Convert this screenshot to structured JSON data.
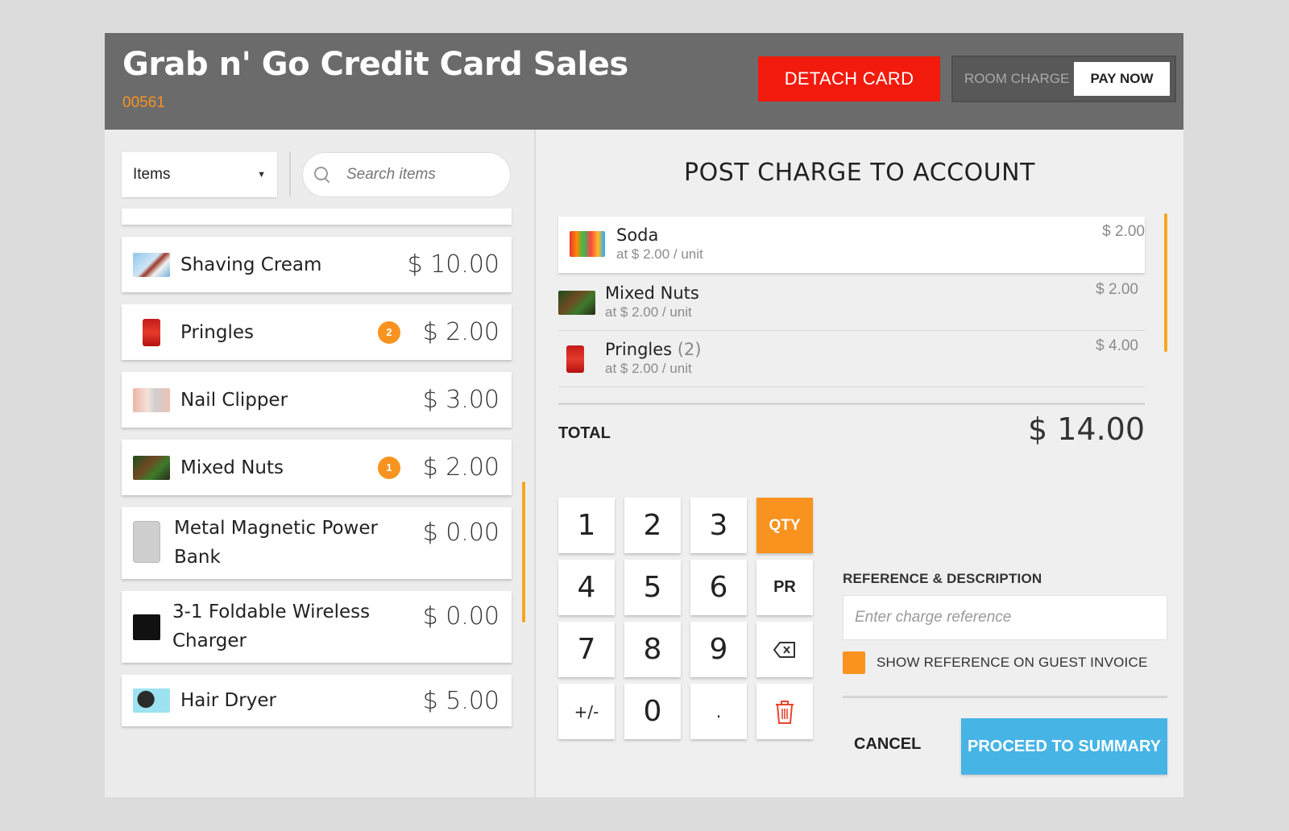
{
  "header": {
    "title": "Grab n' Go Credit Card Sales",
    "id": "00561",
    "detach_label": "DETACH CARD",
    "room_charge_label": "ROOM CHARGE",
    "pay_now_label": "PAY NOW"
  },
  "filter": {
    "category": "Items",
    "search_placeholder": "Search items"
  },
  "catalog": [
    {
      "name": "Shaving Cream",
      "price": "$ 10.00",
      "badge": "",
      "icon": "shaving-cream-thumb"
    },
    {
      "name": "Pringles",
      "price": "$ 2.00",
      "badge": "2",
      "icon": "pringles-thumb"
    },
    {
      "name": "Nail Clipper",
      "price": "$ 3.00",
      "badge": "",
      "icon": "nail-clipper-thumb"
    },
    {
      "name": "Mixed Nuts",
      "price": "$ 2.00",
      "badge": "1",
      "icon": "mixed-nuts-thumb"
    },
    {
      "name": "Metal Magnetic Power Bank",
      "price": "$ 0.00",
      "badge": "",
      "icon": "power-bank-thumb"
    },
    {
      "name": "3-1 Foldable Wireless Charger",
      "price": "$ 0.00",
      "badge": "",
      "icon": "wireless-charger-thumb"
    },
    {
      "name": "Hair Dryer",
      "price": "$ 5.00",
      "badge": "",
      "icon": "hair-dryer-thumb"
    }
  ],
  "order": {
    "title": "POST CHARGE TO ACCOUNT",
    "lines": [
      {
        "name": "Soda",
        "qty": "",
        "unit": "at $ 2.00 / unit",
        "price": "$ 2.00"
      },
      {
        "name": "Mixed Nuts",
        "qty": "",
        "unit": "at $ 2.00 / unit",
        "price": "$ 2.00"
      },
      {
        "name": "Pringles",
        "qty": "(2)",
        "unit": "at $ 2.00 / unit",
        "price": "$ 4.00"
      }
    ],
    "total_label": "TOTAL",
    "total_value": "$ 14.00"
  },
  "keypad": {
    "keys": [
      "1",
      "2",
      "3",
      "QTY",
      "4",
      "5",
      "6",
      "PR",
      "7",
      "8",
      "9",
      "backspace",
      "+/-",
      "0",
      ".",
      "delete"
    ]
  },
  "reference": {
    "label": "REFERENCE & DESCRIPTION",
    "placeholder": "Enter charge reference",
    "show_on_invoice_label": "SHOW REFERENCE ON GUEST INVOICE"
  },
  "actions": {
    "cancel": "CANCEL",
    "proceed": "PROCEED TO SUMMARY"
  },
  "colors": {
    "accent": "#f7931e",
    "detach": "#f11a0d",
    "proceed": "#47b4e6",
    "header_bg": "#6b6b6c"
  }
}
